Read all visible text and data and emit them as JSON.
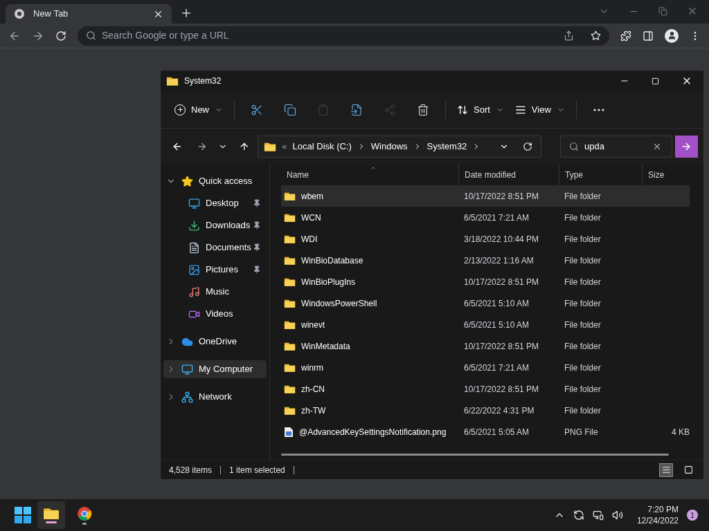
{
  "browser": {
    "tab": {
      "title": "New Tab"
    },
    "omnibox": {
      "placeholder": "Search Google or type a URL"
    }
  },
  "explorer": {
    "title": "System32",
    "toolbar": [
      {
        "kind": "new",
        "label": "New",
        "disabled": false
      },
      {
        "kind": "cut",
        "disabled": false
      },
      {
        "kind": "copy",
        "disabled": false
      },
      {
        "kind": "paste",
        "disabled": true
      },
      {
        "kind": "rename",
        "disabled": false
      },
      {
        "kind": "share",
        "disabled": true
      },
      {
        "kind": "delete",
        "disabled": false
      },
      {
        "kind": "sort",
        "label": "Sort",
        "disabled": false
      },
      {
        "kind": "view",
        "label": "View",
        "disabled": false
      },
      {
        "kind": "more",
        "disabled": false
      }
    ],
    "address": {
      "overflow": "«",
      "segments": [
        "Local Disk (C:)",
        "Windows",
        "System32"
      ]
    },
    "search": {
      "value": "upda"
    },
    "sidebar": [
      {
        "label": "Quick access",
        "kind": "star",
        "expanded": true,
        "selected": false,
        "children": [
          {
            "label": "Desktop",
            "kind": "desktop",
            "pinned": true,
            "selected": false
          },
          {
            "label": "Downloads",
            "kind": "downloads",
            "pinned": true,
            "selected": false
          },
          {
            "label": "Documents",
            "kind": "documents",
            "pinned": true,
            "selected": false
          },
          {
            "label": "Pictures",
            "kind": "pictures",
            "pinned": true,
            "selected": false
          },
          {
            "label": "Music",
            "kind": "music",
            "pinned": false,
            "selected": false
          },
          {
            "label": "Videos",
            "kind": "videos",
            "pinned": false,
            "selected": false
          }
        ]
      },
      {
        "label": "OneDrive",
        "kind": "cloud",
        "expanded": false,
        "selected": false
      },
      {
        "label": "My Computer",
        "kind": "computer",
        "expanded": false,
        "selected": true
      },
      {
        "label": "Network",
        "kind": "network",
        "expanded": false,
        "selected": false
      }
    ],
    "columns": [
      "Name",
      "Date modified",
      "Type",
      "Size"
    ],
    "rows": [
      {
        "name": "wbem",
        "date": "10/17/2022 8:51 PM",
        "type": "File folder",
        "kind": "folder",
        "selected": true
      },
      {
        "name": "WCN",
        "date": "6/5/2021 7:21 AM",
        "type": "File folder",
        "kind": "folder",
        "selected": false
      },
      {
        "name": "WDI",
        "date": "3/18/2022 10:44 PM",
        "type": "File folder",
        "kind": "folder",
        "selected": false
      },
      {
        "name": "WinBioDatabase",
        "date": "2/13/2022 1:16 AM",
        "type": "File folder",
        "kind": "folder",
        "selected": false
      },
      {
        "name": "WinBioPlugIns",
        "date": "10/17/2022 8:51 PM",
        "type": "File folder",
        "kind": "folder",
        "selected": false
      },
      {
        "name": "WindowsPowerShell",
        "date": "6/5/2021 5:10 AM",
        "type": "File folder",
        "kind": "folder",
        "selected": false
      },
      {
        "name": "winevt",
        "date": "6/5/2021 5:10 AM",
        "type": "File folder",
        "kind": "folder",
        "selected": false
      },
      {
        "name": "WinMetadata",
        "date": "10/17/2022 8:51 PM",
        "type": "File folder",
        "kind": "folder",
        "selected": false
      },
      {
        "name": "winrm",
        "date": "6/5/2021 7:21 AM",
        "type": "File folder",
        "kind": "folder",
        "selected": false
      },
      {
        "name": "zh-CN",
        "date": "10/17/2022 8:51 PM",
        "type": "File folder",
        "kind": "folder",
        "selected": false
      },
      {
        "name": "zh-TW",
        "date": "6/22/2022 4:31 PM",
        "type": "File folder",
        "kind": "folder",
        "selected": false
      },
      {
        "name": "@AdvancedKeySettingsNotification.png",
        "date": "6/5/2021 5:05 AM",
        "type": "PNG File",
        "size": "4 KB",
        "kind": "image",
        "selected": false
      }
    ],
    "status": {
      "count": "4,528 items",
      "selection": "1 item selected"
    },
    "views": [
      {
        "kind": "details",
        "selected": true
      },
      {
        "kind": "tiles",
        "selected": false
      }
    ]
  },
  "taskbar": {
    "apps": [
      {
        "kind": "explorer",
        "active": true
      },
      {
        "kind": "chrome",
        "active": false
      }
    ],
    "time": "7:20 PM",
    "date": "12/24/2022",
    "badge": "1"
  }
}
